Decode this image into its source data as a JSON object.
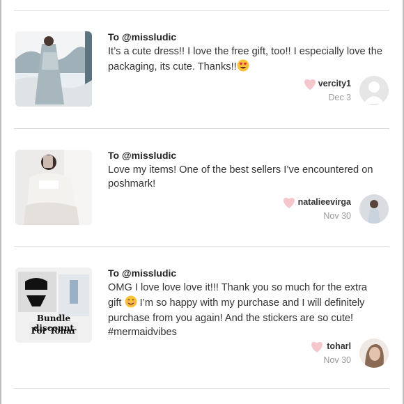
{
  "reviews": [
    {
      "to": "To @missludic",
      "message": "It’s a cute dress!! I love the free gift, too!! I especially love the packaging, its cute. Thanks!!",
      "emoji": "heart-eyes",
      "username": "vercity1",
      "date": "Dec 3",
      "icons": {
        "like": "heart-icon",
        "avatar": "default-avatar-icon"
      }
    },
    {
      "to": "To @missludic",
      "message": "Love my items! One of the best sellers I’ve encountered on poshmark!",
      "username": "natalieevirga",
      "date": "Nov 30",
      "icons": {
        "like": "heart-icon",
        "avatar": "user-photo"
      }
    },
    {
      "to": "To @missludic",
      "message_part1": "OMG I love love love it!!! Thank you so much for the extra gift",
      "message_part2": " I’m so happy with my purchase and I will definitely purchase from you again! And the stickers are so cute! #mermaidvibes",
      "emoji": "smiling-face",
      "username": "toharl",
      "date": "Nov 30",
      "thumb_text": [
        "Bundle discount",
        "For Tohar"
      ],
      "icons": {
        "like": "heart-icon",
        "avatar": "user-photo"
      }
    }
  ],
  "colors": {
    "heart": "#f5c6cc",
    "divider": "#dcdcdc",
    "date": "#9a9a9a"
  }
}
